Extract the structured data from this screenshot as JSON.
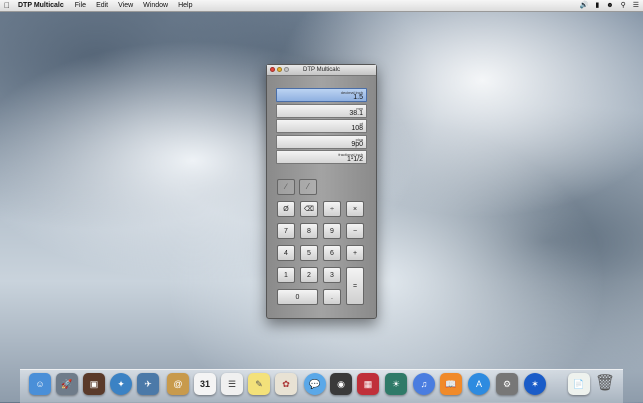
{
  "menubar": {
    "app_name": "DTP Multicalc",
    "menus": [
      "File",
      "Edit",
      "View",
      "Window",
      "Help"
    ]
  },
  "window": {
    "title": "DTP Multicalc",
    "units": [
      {
        "label": "decimal inch",
        "value": "1.5"
      },
      {
        "label": "mm",
        "value": "38.1"
      },
      {
        "label": "pt",
        "value": "108"
      },
      {
        "label": "pica",
        "value": "9p0"
      },
      {
        "label": "fractional inch",
        "value": "1¹1/2"
      }
    ],
    "keys": {
      "clear": "Ø",
      "backspace": "⌫",
      "divide": "÷",
      "multiply": "×",
      "seven": "7",
      "eight": "8",
      "nine": "9",
      "minus": "−",
      "four": "4",
      "five": "5",
      "six": "6",
      "plus": "+",
      "one": "1",
      "two": "2",
      "three": "3",
      "equals": "=",
      "zero": "0",
      "decimal": "."
    }
  },
  "dock": {
    "apps": [
      "finder",
      "launchpad",
      "photo-booth",
      "safari",
      "preview",
      "contacts",
      "calendar",
      "reminders",
      "notes",
      "mail-photos",
      "messages",
      "facetime",
      "photo-app",
      "preview-stack",
      "itunes",
      "ibooks",
      "app-store",
      "system-preferences",
      "dashboard",
      "documents",
      "trash"
    ],
    "calendar_day": "31"
  }
}
